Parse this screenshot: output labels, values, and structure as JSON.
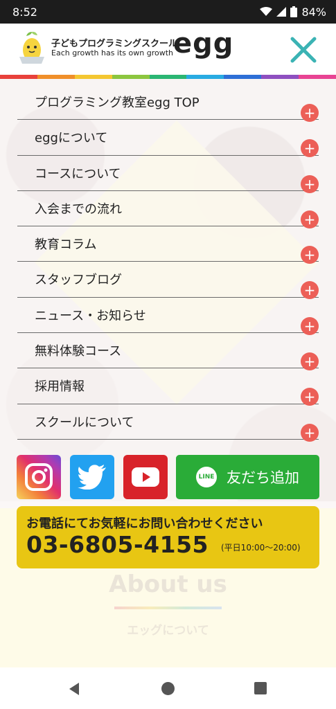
{
  "status_bar": {
    "time": "8:52",
    "battery": "84%"
  },
  "header": {
    "logo_jp": "子どもプログラミングスクール",
    "logo_en": "Each growth has its own growth",
    "logo_word": "egg"
  },
  "stripe_colors": [
    "#e8413b",
    "#f08f2a",
    "#f4c731",
    "#8cc63f",
    "#2bb673",
    "#29abe2",
    "#2e6fd6",
    "#8e4fc0",
    "#e84393"
  ],
  "menu": {
    "items": [
      {
        "label": "プログラミング教室egg TOP"
      },
      {
        "label": "eggについて"
      },
      {
        "label": "コースについて"
      },
      {
        "label": "入会までの流れ"
      },
      {
        "label": "教育コラム"
      },
      {
        "label": "スタッフブログ"
      },
      {
        "label": "ニュース・お知らせ"
      },
      {
        "label": "無料体験コース"
      },
      {
        "label": "採用情報"
      },
      {
        "label": "スクールについて"
      }
    ],
    "expand_symbol": "+"
  },
  "social": {
    "line_label": "友だち追加",
    "line_badge": "LINE"
  },
  "phone": {
    "title": "お電話にてお気軽にお問い合わせください",
    "number": "03-6805-4155",
    "hours": "(平日10:00～20:00)"
  },
  "background": {
    "about_title": "About us",
    "about_sub": "エッグについて"
  },
  "colors": {
    "accent_close": "#3bb3b4",
    "plus_button": "#ec5f57",
    "line_green": "#2aac38",
    "phone_yellow": "#e8c613"
  }
}
